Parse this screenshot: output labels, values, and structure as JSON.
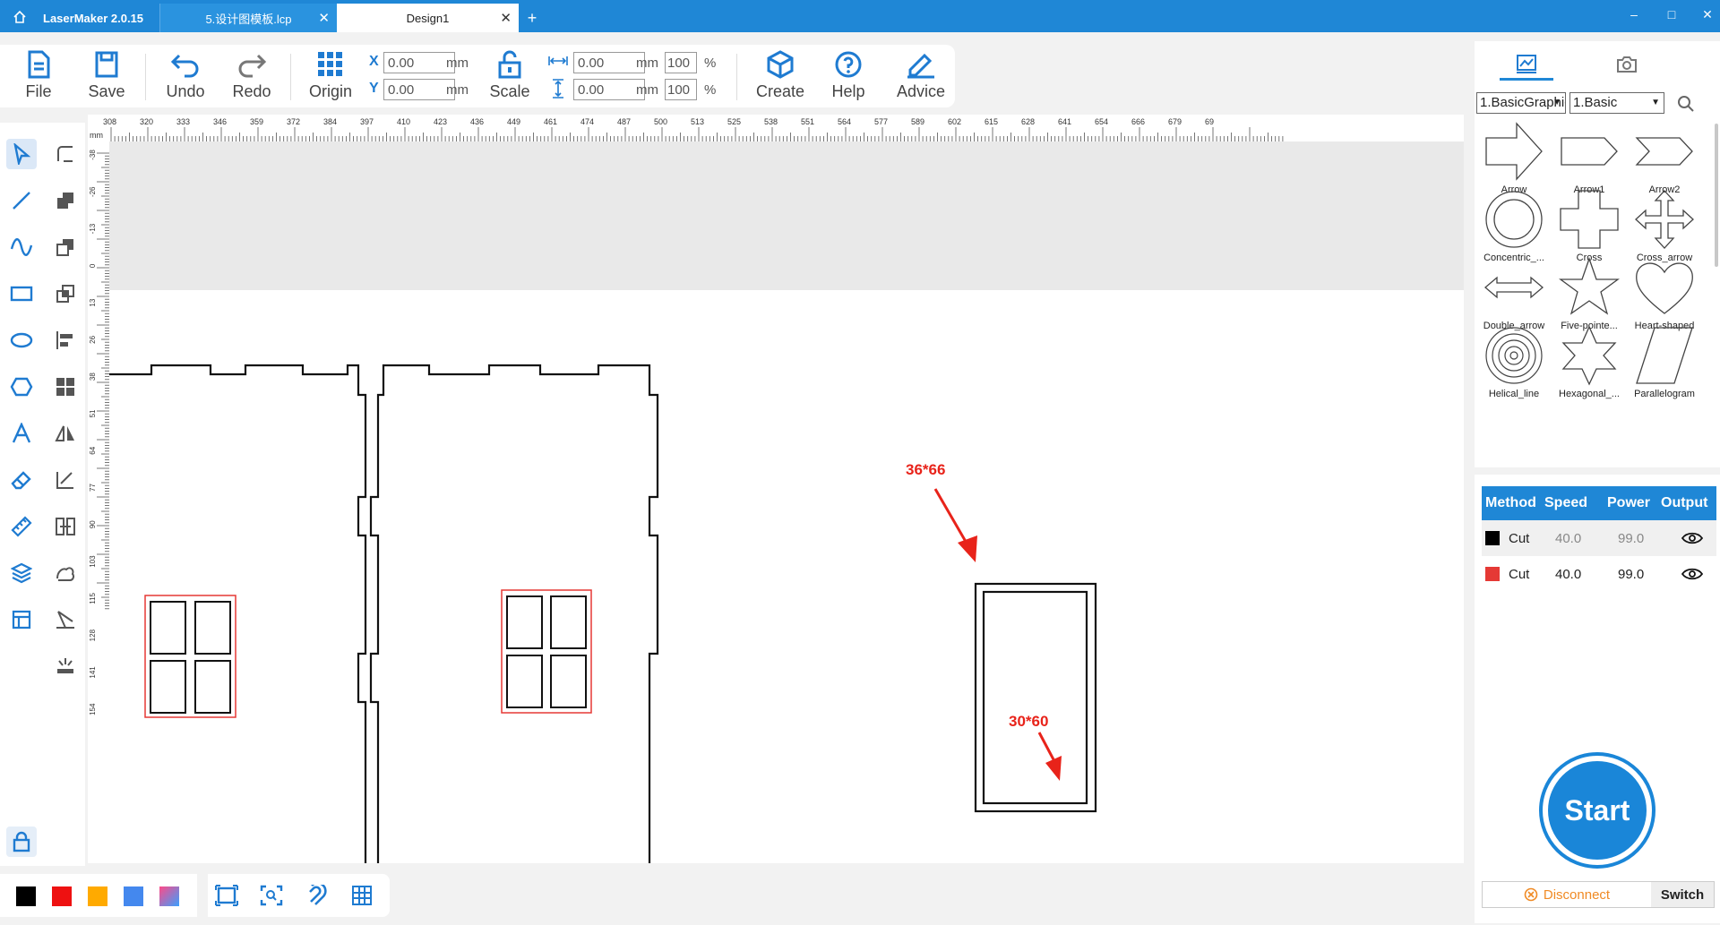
{
  "titlebar": {
    "app_title": "LaserMaker 2.0.15",
    "tabs": [
      {
        "label": "5.设计图模板.lcp"
      },
      {
        "label": "Design1"
      }
    ],
    "add_tab": "+",
    "minimize": "–",
    "maximize": "□",
    "close": "✕"
  },
  "toolbar": {
    "file": "File",
    "save": "Save",
    "undo": "Undo",
    "redo": "Redo",
    "origin": "Origin",
    "scale": "Scale",
    "create": "Create",
    "help": "Help",
    "advice": "Advice",
    "x_label": "X",
    "y_label": "Y",
    "x_value": "0.00",
    "y_value": "0.00",
    "w_value": "0.00",
    "h_value": "0.00",
    "w_pct": "100",
    "h_pct": "100",
    "unit": "mm",
    "pct": "%"
  },
  "ruler": {
    "unit": "mm",
    "top_ticks": [
      "308",
      "320",
      "333",
      "346",
      "359",
      "372",
      "384",
      "397",
      "410",
      "423",
      "436",
      "449",
      "461",
      "474",
      "487",
      "500",
      "513",
      "525",
      "538",
      "551",
      "564",
      "577",
      "589",
      "602",
      "615",
      "628",
      "641",
      "654",
      "666",
      "679",
      "69"
    ],
    "left_ticks": [
      "-38",
      "-26",
      "-13",
      "0",
      "13",
      "26",
      "38",
      "51",
      "64",
      "77",
      "90",
      "103",
      "115",
      "128",
      "141",
      "154"
    ]
  },
  "annotations": {
    "outer": "36*66",
    "inner": "30*60"
  },
  "colors": {
    "swatches": [
      "#000000",
      "#ee1111",
      "#ffaa00",
      "#4488ee"
    ],
    "accent": "#1f87d6",
    "annotation": "#e8231a"
  },
  "library": {
    "category": "1.BasicGraphics",
    "subcategory": "1.Basic",
    "shapes": [
      {
        "name": "Arrow"
      },
      {
        "name": "Arrow1"
      },
      {
        "name": "Arrow2"
      },
      {
        "name": "Concentric_..."
      },
      {
        "name": "Cross"
      },
      {
        "name": "Cross_arrow"
      },
      {
        "name": "Double_arrow"
      },
      {
        "name": "Five-pointe..."
      },
      {
        "name": "Heart-shaped"
      },
      {
        "name": "Helical_line"
      },
      {
        "name": "Hexagonal_..."
      },
      {
        "name": "Parallelogram"
      }
    ]
  },
  "layers": {
    "headers": [
      "Method",
      "Speed",
      "Power",
      "Output"
    ],
    "rows": [
      {
        "color": "#000000",
        "method": "Cut",
        "speed": "40.0",
        "power": "99.0"
      },
      {
        "color": "#e53935",
        "method": "Cut",
        "speed": "40.0",
        "power": "99.0"
      }
    ]
  },
  "start_label": "Start",
  "disconnect_label": "Disconnect",
  "switch_label": "Switch"
}
